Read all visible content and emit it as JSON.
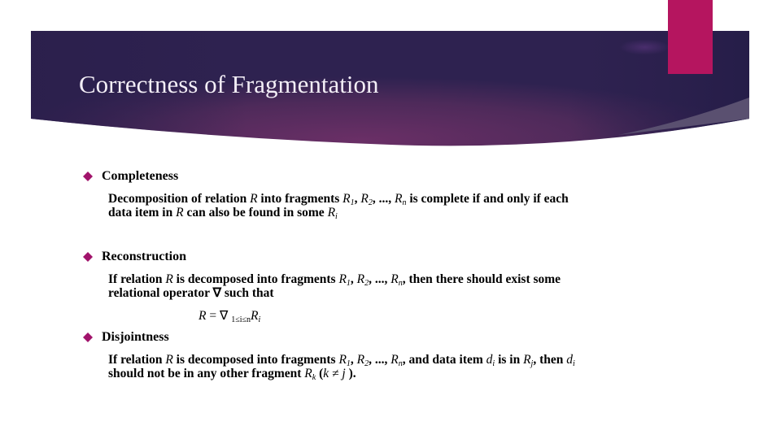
{
  "slide": {
    "title": "Correctness of Fragmentation",
    "colors": {
      "banner_dark": "#2a1f4a",
      "banner_mid": "#6a2f66",
      "banner_highlight": "#4a2f6a",
      "accent_bar": "#b5155f",
      "bullet": "#a1136b",
      "title_text": "#f3eef6",
      "swoosh": "#5a5070"
    }
  },
  "sections": [
    {
      "heading": "Completeness",
      "bullet_icon": "diamond-bullet",
      "lines": [
        [
          {
            "t": "Decomposition of relation "
          },
          {
            "m": "R"
          },
          {
            "t": " into fragments "
          },
          {
            "m": "R",
            "sub": "1"
          },
          {
            "t": ", "
          },
          {
            "m": "R",
            "sub": "2"
          },
          {
            "t": ", ..., "
          },
          {
            "m": "R",
            "sub": "n"
          },
          {
            "t": " is complete if and only if each"
          }
        ],
        [
          {
            "t": "data item in "
          },
          {
            "m": "R"
          },
          {
            "t": " can also be found in some "
          },
          {
            "m": "R",
            "sub": "i"
          }
        ]
      ]
    },
    {
      "heading": "Reconstruction",
      "bullet_icon": "diamond-bullet",
      "lines": [
        [
          {
            "t": "If relation "
          },
          {
            "m": "R"
          },
          {
            "t": "  is decomposed into fragments "
          },
          {
            "m": "R",
            "sub": "1"
          },
          {
            "t": ", "
          },
          {
            "m": "R",
            "sub": "2"
          },
          {
            "t": ", ..., "
          },
          {
            "m": "R",
            "sub": "n"
          },
          {
            "t": ", then there should exist some"
          }
        ],
        [
          {
            "t": "relational operator "
          },
          {
            "o": " ∇ "
          },
          {
            "t": " such that"
          }
        ]
      ],
      "formula": [
        {
          "m": "R"
        },
        {
          "o": " = ∇ "
        },
        {
          "o": "",
          "sub": "1≤i≤n"
        },
        {
          "m": "R",
          "sub": "i"
        }
      ]
    },
    {
      "heading": "Disjointness",
      "bullet_icon": "diamond-bullet",
      "lines": [
        [
          {
            "t": "If relation "
          },
          {
            "m": "R"
          },
          {
            "t": " is decomposed into fragments "
          },
          {
            "m": "R",
            "sub": "1"
          },
          {
            "t": ", "
          },
          {
            "m": "R",
            "sub": "2"
          },
          {
            "t": ", ..., "
          },
          {
            "m": "R",
            "sub": "n"
          },
          {
            "t": ", and data item "
          },
          {
            "m": "d",
            "sub": "i"
          },
          {
            "t": " is in "
          },
          {
            "m": "R",
            "sub": "j"
          },
          {
            "t": ", then "
          },
          {
            "m": "d",
            "sub": "i"
          }
        ],
        [
          {
            "t": "should not be in any other fragment "
          },
          {
            "m": "R",
            "sub": "k"
          },
          {
            "t": " ("
          },
          {
            "m": "k ≠ j"
          },
          {
            "t": " )."
          }
        ]
      ]
    }
  ]
}
